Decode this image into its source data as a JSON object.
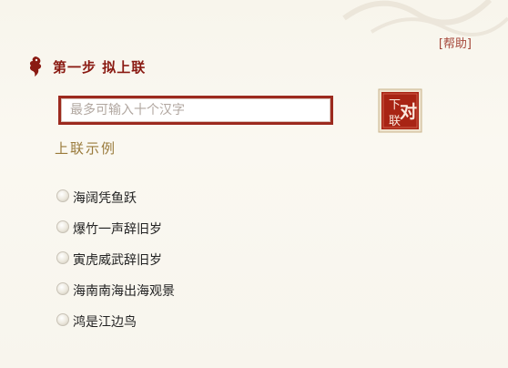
{
  "help": {
    "label": "[帮助]"
  },
  "step": {
    "title": "第一步 拟上联"
  },
  "input": {
    "placeholder": "最多可输入十个汉字",
    "value": ""
  },
  "submit": {
    "stamp_chars": [
      "下",
      "联",
      "对"
    ]
  },
  "examples": {
    "title": "上联示例",
    "items": [
      {
        "label": "海阔凭鱼跃"
      },
      {
        "label": "爆竹一声辞旧岁"
      },
      {
        "label": "寅虎威武辞旧岁"
      },
      {
        "label": "海南南海出海观景"
      },
      {
        "label": "鸿是江边鸟"
      }
    ]
  },
  "colors": {
    "accent_red": "#9c2a1e",
    "title_red": "#8a1a12",
    "section_gold": "#9a7b3c",
    "help_red": "#a5473a",
    "background": "#f9f6ee"
  }
}
